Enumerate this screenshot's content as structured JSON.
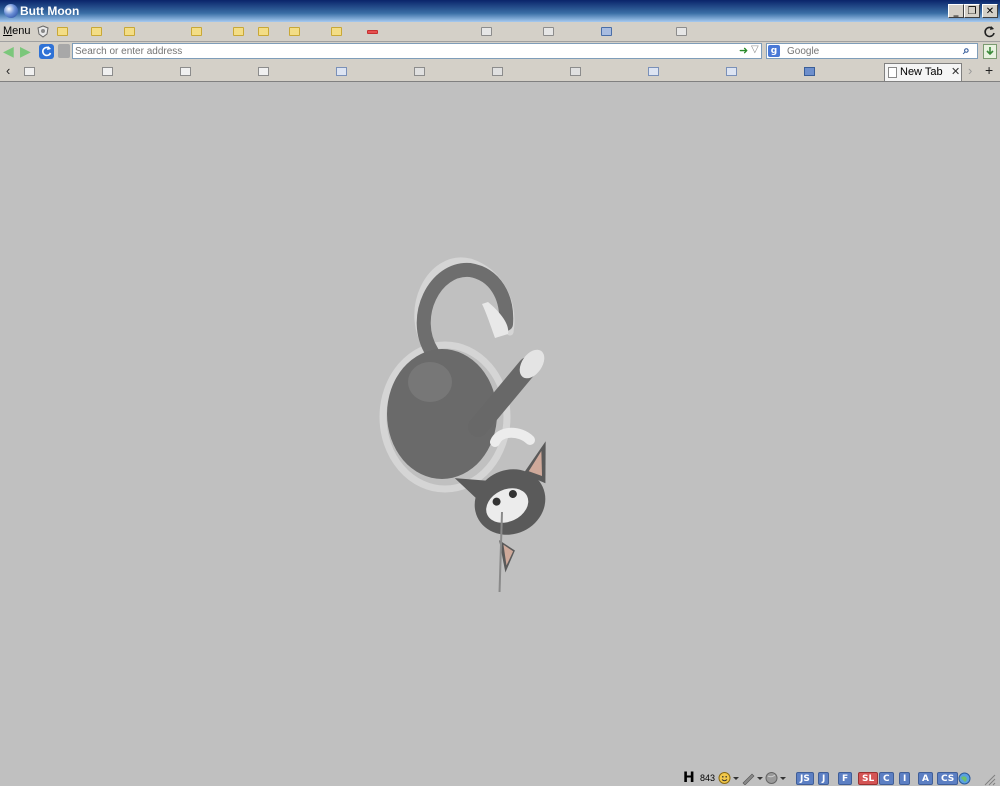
{
  "window": {
    "title": "Butt Moon",
    "minimize": "_",
    "restore": "❐",
    "close": "✕"
  },
  "menubar": {
    "menu_label": "Menu",
    "menu_accel": "M",
    "menu_rest": "enu"
  },
  "navbar": {
    "back_glyph": "◀",
    "forward_glyph": "▶",
    "address_placeholder": "Search or enter address",
    "go_glyph": "➜",
    "dropdown_glyph": "▽",
    "search_engine_label": "g",
    "search_placeholder": "Google",
    "search_glyph": "⌕"
  },
  "tabbar": {
    "scroll_left": "‹",
    "scroll_right": "›",
    "new_tab": "+",
    "active_tab_label": "New Tab",
    "active_tab_close": "✕"
  },
  "statusbar": {
    "h_label": "H",
    "h_count": "843",
    "buttons": [
      "JS",
      "J",
      "F",
      "SL",
      "C",
      "I",
      "A",
      "CS"
    ]
  },
  "colors": {
    "titlebar": "#0a246a",
    "background": "#c0c0c0",
    "accent": "#5c7fc3",
    "status_red": "#d45454"
  },
  "icons": [
    "globe-icon",
    "shield-icon",
    "refresh-icon",
    "back-arrow-icon",
    "forward-arrow-icon",
    "google-icon",
    "download-icon",
    "smiley-icon",
    "pencil-icon",
    "earth-icon"
  ]
}
